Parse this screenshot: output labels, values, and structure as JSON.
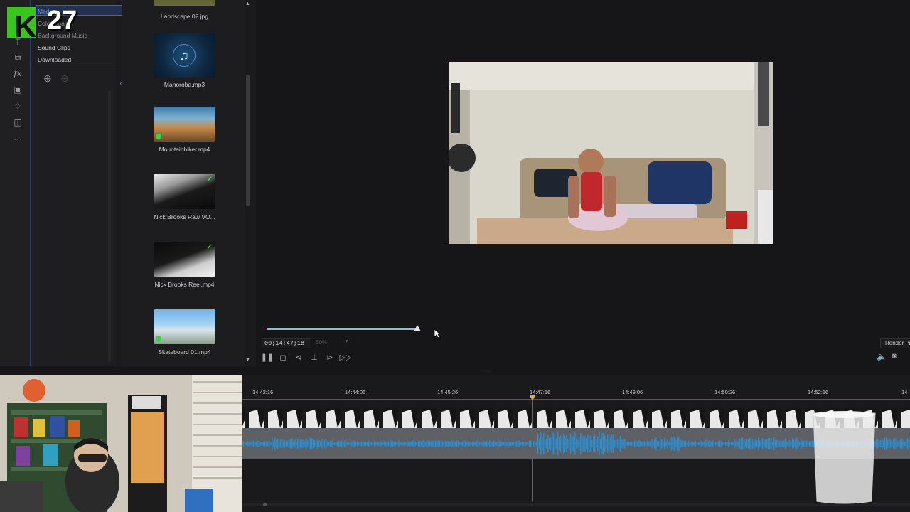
{
  "badge": {
    "letter": "K",
    "number": "27"
  },
  "categories": {
    "items": [
      {
        "label": "Media"
      },
      {
        "label": "Color Boards"
      },
      {
        "label": "Background Music"
      },
      {
        "label": "Sound Clips"
      },
      {
        "label": "Downloaded"
      }
    ]
  },
  "media": {
    "items": [
      {
        "label": "Landscape 02.jpg"
      },
      {
        "label": "Mahoroba.mp3"
      },
      {
        "label": "Mountainbiker.mp4"
      },
      {
        "label": "Nick Brooks Raw VO..."
      },
      {
        "label": "Nick Brooks Reel.mp4"
      },
      {
        "label": "Skateboard 01.mp4"
      }
    ]
  },
  "player": {
    "timecode": "00;14;47;18",
    "quality": "50%",
    "progress_fraction": 0.25,
    "render_label": "Render Pr"
  },
  "timeline": {
    "ticks": [
      "14:42:16",
      "14:44:06",
      "14:45:26",
      "14:47:16",
      "14:49:06",
      "14:50:26",
      "14:52:16",
      "14"
    ]
  },
  "colors": {
    "accent": "#3a5bd9",
    "progress": "#6fc7e0",
    "playhead": "#e02a2a",
    "badge_green": "#39c61a"
  }
}
